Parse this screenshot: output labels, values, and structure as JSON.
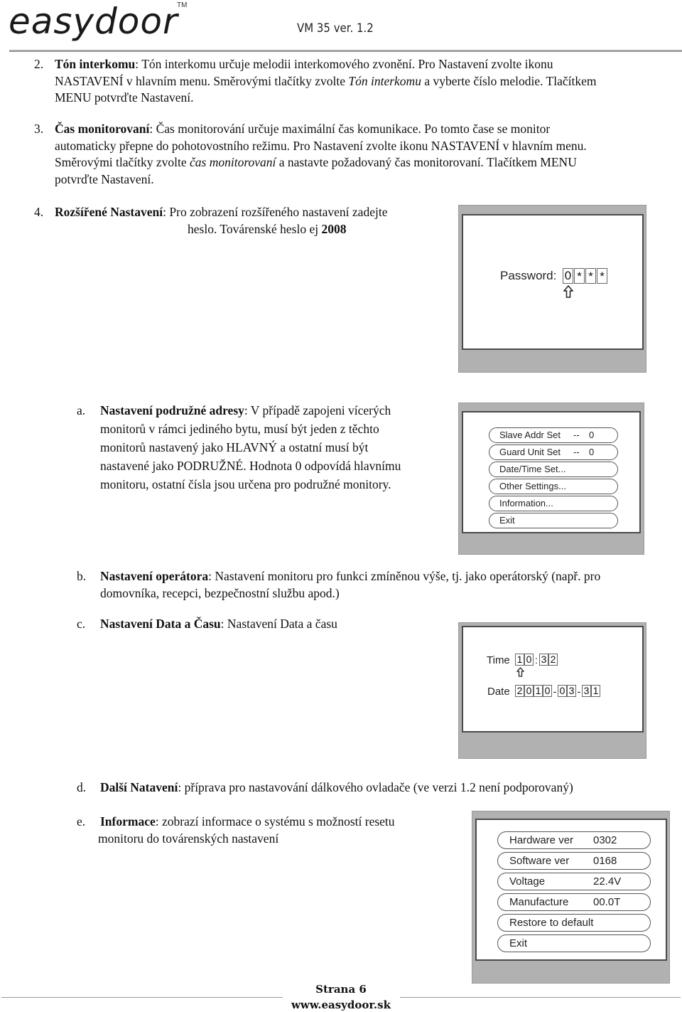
{
  "header": {
    "logo_text": "easydoor",
    "trademark": "TM",
    "version": "VM 35 ver. 1.2"
  },
  "sections": {
    "s2": {
      "number": "2.",
      "title": "Tón interkomu",
      "line1_rest": ": Tón interkomu určuje melodii interkomového zvonění. Pro Nastavení zvolte ikonu",
      "line2_a": "NASTAVENÍ v hlavním menu. Směrovými tlačítky zvolte ",
      "line2_italic": "Tón interkomu",
      "line2_b": " a vyberte číslo melodie. Tlačítkem",
      "line3": "MENU potvrďte Nastavení."
    },
    "s3": {
      "number": "3.",
      "title": "Čas monitorovaní",
      "line1_rest": ": Čas monitorování určuje maximální čas komunikace. Po tomto čase se monitor",
      "line2": "automaticky přepne do pohotovostního režimu. Pro Nastavení zvolte ikonu NASTAVENÍ v hlavním menu.",
      "line3_a": "Směrovými tlačítky zvolte ",
      "line3_italic": "čas monitorovaní",
      "line3_b": " a nastavte požadovaný čas monitorovaní. Tlačítkem MENU",
      "line4": "potvrďte Nastavení."
    },
    "s4": {
      "number": "4.",
      "title": "Rozšířené Nastavení",
      "line1_rest": ": Pro zobrazení rozšířeného nastavení zadejte",
      "line2_a": "heslo. Továrenské heslo ej ",
      "line2_bold": "2008"
    },
    "sa": {
      "letter": "a.",
      "title": "Nastavení podružné adresy",
      "line1_rest": ": V případě zapojeni vícerých",
      "line2": "monitorů v rámci jediného bytu, musí být jeden z těchto",
      "line3": "monitorů nastavený jako HLAVNÝ a ostatní musí být",
      "line4": "nastavené jako PODRUŽNÉ. Hodnota 0 odpovídá hlavnímu",
      "line5": "monitoru, ostatní čísla jsou určena pro podružné monitory."
    },
    "sb": {
      "letter": "b.",
      "title": "Nastavení operátora",
      "line1_rest": ": Nastavení monitoru pro funkci zmíněnou výše, tj. jako operátorský (např. pro",
      "line2": "domovníka, recepci, bezpečnostní službu apod.)"
    },
    "sc": {
      "letter": "c.",
      "title": "Nastavení Data a Času",
      "line1_rest": ": Nastavení Data a času"
    },
    "sd": {
      "letter": "d.",
      "title": "Další Natavení",
      "line1_rest": ": příprava pro nastavování dálkového ovladače (ve verzi 1.2 není podporovaný)"
    },
    "se": {
      "letter": "e.",
      "title": "Informace",
      "line1_rest": ": zobrazí informace o systému s možností resetu",
      "line2": "monitoru do továrenských nastavení"
    }
  },
  "password_screen": {
    "label": "Password:",
    "digits": [
      "0",
      "*",
      "*",
      "*"
    ],
    "cursor_icon": "up-arrow-icon"
  },
  "settings_menu": {
    "items": [
      {
        "label": "Slave Addr Set",
        "sep": "--",
        "value": "0"
      },
      {
        "label": "Guard Unit Set",
        "sep": "--",
        "value": "0"
      },
      {
        "label": "Date/Time Set...",
        "sep": "",
        "value": ""
      },
      {
        "label": "Other Settings...",
        "sep": "",
        "value": ""
      },
      {
        "label": "Information...",
        "sep": "",
        "value": ""
      },
      {
        "label": "Exit",
        "sep": "",
        "value": ""
      }
    ]
  },
  "datetime_screen": {
    "time_label": "Time",
    "time_digits": [
      "1",
      "0",
      "3",
      "2"
    ],
    "time_sep": ":",
    "date_label": "Date",
    "date_digits": [
      "2",
      "0",
      "1",
      "0",
      "0",
      "3",
      "3",
      "1"
    ],
    "date_sep": "-",
    "cursor_icon": "up-arrow-icon"
  },
  "info_menu": {
    "items": [
      {
        "label": "Hardware ver",
        "value": "0302"
      },
      {
        "label": "Software ver",
        "value": "0168"
      },
      {
        "label": "Voltage",
        "value": "22.4V"
      },
      {
        "label": "Manufacture",
        "value": "00.0T"
      },
      {
        "label": "Restore to default",
        "value": ""
      },
      {
        "label": "Exit",
        "value": ""
      }
    ]
  },
  "footer": {
    "page": "Strana 6",
    "website": "www.easydoor.sk"
  }
}
